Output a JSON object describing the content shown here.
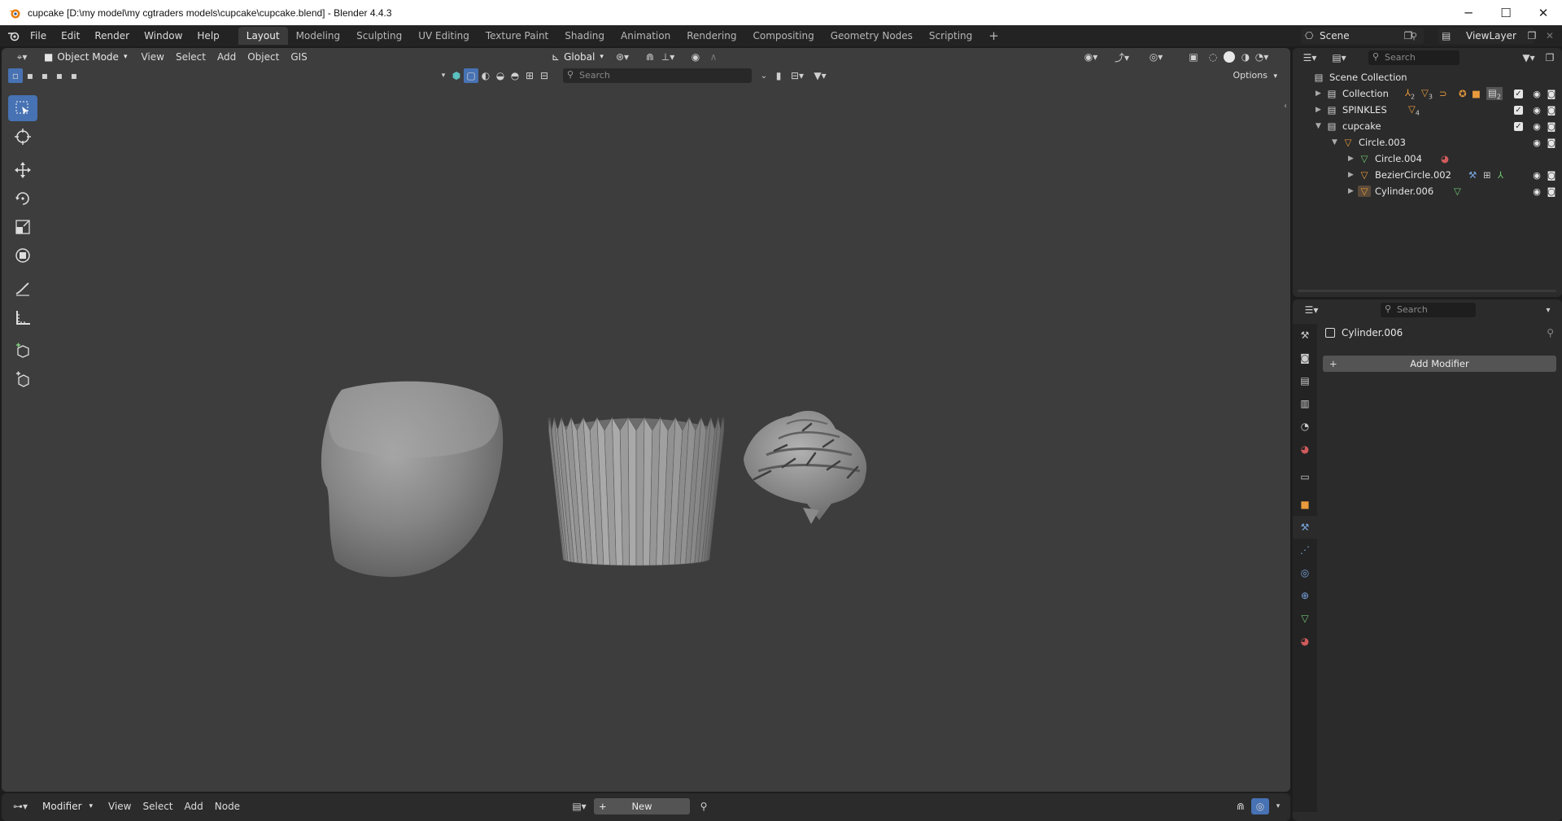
{
  "window": {
    "title": "cupcake [D:\\my model\\my cgtraders models\\cupcake\\cupcake.blend] - Blender 4.4.3",
    "controls": [
      "─",
      "☐",
      "✕"
    ]
  },
  "menubar": {
    "items": [
      "File",
      "Edit",
      "Render",
      "Window",
      "Help"
    ],
    "workspace_tabs": [
      "Layout",
      "Modeling",
      "Sculpting",
      "UV Editing",
      "Texture Paint",
      "Shading",
      "Animation",
      "Rendering",
      "Compositing",
      "Geometry Nodes",
      "Scripting"
    ],
    "active_tab": "Layout",
    "add_tab": "+",
    "scene": "Scene",
    "view_layer": "ViewLayer"
  },
  "viewport": {
    "mode": "Object Mode",
    "menus": [
      "View",
      "Select",
      "Add",
      "Object",
      "GIS"
    ],
    "orientation": "Global",
    "search_placeholder": "Search",
    "options_label": "Options",
    "background": "#3d3d3d"
  },
  "tools": [
    "select-box",
    "cursor",
    "move",
    "rotate",
    "scale",
    "transform",
    "annotate",
    "measure",
    "add-cube",
    "add-cube-alt"
  ],
  "outliner": {
    "search_placeholder": "Search",
    "rows": [
      {
        "label": "Scene Collection",
        "level": 0,
        "type": "scene"
      },
      {
        "label": "Collection",
        "level": 1,
        "type": "collection",
        "expanded": false
      },
      {
        "label": "SPINKLES",
        "level": 1,
        "type": "collection",
        "expanded": false
      },
      {
        "label": "cupcake",
        "level": 1,
        "type": "collection",
        "expanded": true
      },
      {
        "label": "Circle.003",
        "level": 2,
        "type": "mesh",
        "expanded": true
      },
      {
        "label": "Circle.004",
        "level": 3,
        "type": "curve",
        "expanded": false
      },
      {
        "label": "BezierCircle.002",
        "level": 3,
        "type": "mesh",
        "expanded": false
      },
      {
        "label": "Cylinder.006",
        "level": 3,
        "type": "mesh",
        "expanded": false
      }
    ],
    "badges": {
      "collection_a": "2",
      "collection_b": "3",
      "collection_c": "2",
      "spinkles": "4"
    }
  },
  "properties": {
    "search_placeholder": "Search",
    "object_name": "Cylinder.006",
    "add_modifier_label": "Add Modifier"
  },
  "bottom": {
    "editor_type": "Modifier",
    "menus": [
      "View",
      "Select",
      "Add",
      "Node"
    ],
    "new_label": "New"
  },
  "colors": {
    "accent": "#4772b3",
    "mesh_orange": "#e89a3c",
    "curve_green": "#6fc66f",
    "material_red": "#d05a5a"
  }
}
